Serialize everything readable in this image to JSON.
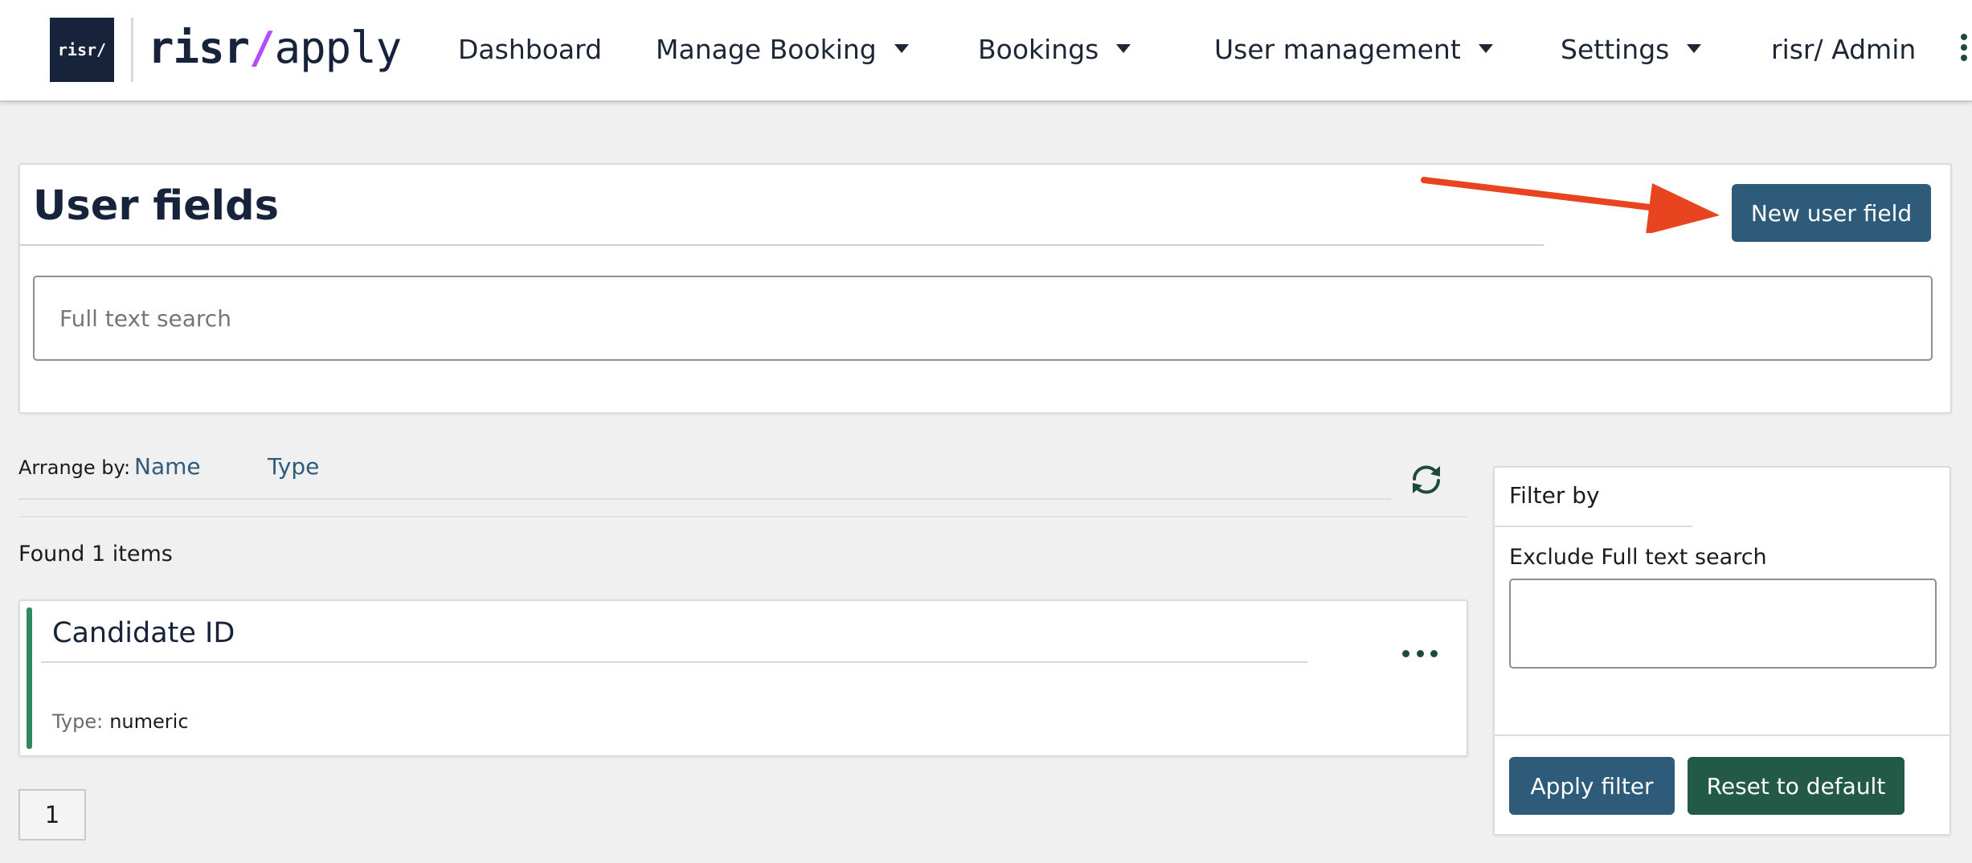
{
  "header": {
    "logo_box_text": "risr/",
    "brand_prefix": "risr",
    "brand_slash": "/",
    "brand_suffix": "apply",
    "nav": {
      "dashboard": "Dashboard",
      "manage_booking": "Manage Booking",
      "bookings": "Bookings",
      "user_management": "User management",
      "settings": "Settings",
      "admin": "risr/ Admin"
    }
  },
  "main": {
    "title": "User fields",
    "new_button_label": "New user field",
    "search_placeholder": "Full text search",
    "search_value": ""
  },
  "arrange": {
    "label": "Arrange by:",
    "options": [
      "Name",
      "Type"
    ]
  },
  "results": {
    "found_text": "Found 1 items",
    "items": [
      {
        "title": "Candidate ID",
        "type_label": "Type:",
        "type_value": "numeric"
      }
    ]
  },
  "pagination": {
    "current_page": "1"
  },
  "filter": {
    "title": "Filter by",
    "exclude_label": "Exclude Full text search",
    "exclude_value": "",
    "apply_label": "Apply filter",
    "reset_label": "Reset to default"
  },
  "colors": {
    "primary": "#2e5b7a",
    "secondary": "#235a47",
    "accent_item": "#2f8a5e",
    "brand_slash": "#b34bff",
    "annotation_arrow": "#e8441f"
  },
  "icons": {
    "refresh": "refresh-icon",
    "more": "more-horizontal-icon",
    "kebab": "more-vertical-icon",
    "caret": "caret-down-icon"
  }
}
